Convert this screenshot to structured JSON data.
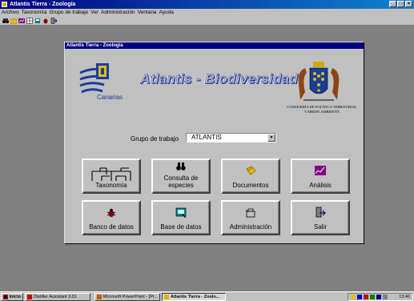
{
  "window": {
    "title": "Atlantis Tierra - Zoología"
  },
  "menu": [
    "Archivo",
    "Taxonomía",
    "Grupo de trabajo",
    "Ver",
    "Administración",
    "Ventana",
    "Ayuda"
  ],
  "toolbar": {
    "icons": [
      "binoculars-icon",
      "folder-icon",
      "chart-icon",
      "grid-icon",
      "database-icon",
      "bug-icon",
      "exit-icon"
    ]
  },
  "dialog": {
    "title": "Atlantis Tierra - Zoología",
    "heading": "Atlantis - Biodiversidad",
    "logo_text": "Canarias",
    "institution": "CONSEJERÍA DE POLÍTICA TERRITORIAL Y MEDIO AMBIENTE",
    "group_label": "Grupo de trabajo",
    "group_value": "ATLANTIS"
  },
  "buttons": {
    "taxonomia": "Taxonomía",
    "consulta": "Consulta de especies",
    "documentos": "Documentos",
    "analisis": "Análisis",
    "banco": "Banco de datos",
    "base": "Base de datos",
    "administracion": "Administración",
    "salir": "Salir"
  },
  "taskbar": {
    "start": "Inicio",
    "tasks": [
      "Distiller Assistant 3.01",
      "Microsoft PowerPoint - [Pr...",
      "Atlantis Tierra - Zoolo..."
    ],
    "clock": "13:46"
  },
  "colors": {
    "title_bar": "#000080",
    "window_bg": "#c0c0c0",
    "desktop": "#808080"
  }
}
